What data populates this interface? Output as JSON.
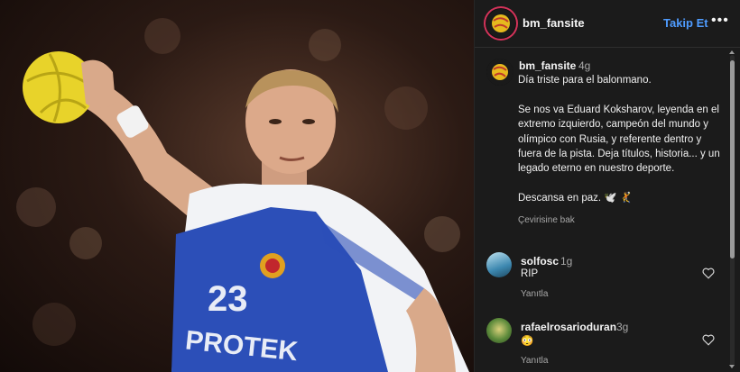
{
  "post": {
    "username": "bm_fansite",
    "follow_label": "Takip Et",
    "more_label": "•••",
    "time": "4g",
    "caption": "Día triste para el balonmano.\n\nSe nos va Eduard Koksharov, leyenda en el extremo izquierdo, campeón del mundo y olímpico con Rusia, y referente dentro y fuera de la pista. Deja títulos, historia... y un legado eterno en nuestro deporte.\n\nDescansa en paz. 🕊️ 🤾",
    "translate_label": "Çevirisine bak"
  },
  "photo": {
    "jersey_number": "23",
    "jersey_sponsor": "PROTEK"
  },
  "comments": [
    {
      "username": "solfosc",
      "time": "1g",
      "text": "RIP",
      "reply_label": "Yanıtla"
    },
    {
      "username": "rafaelrosarioduran",
      "time": "3g",
      "text": "😳",
      "reply_label": "Yanıtla"
    }
  ],
  "colors": {
    "follow": "#4f9cff",
    "panel_bg": "#1b1b1b",
    "jersey_blue": "#2c4fb8"
  },
  "icons": [
    "more-options-icon",
    "heart-icon",
    "scroll-up-icon",
    "scroll-down-icon"
  ]
}
